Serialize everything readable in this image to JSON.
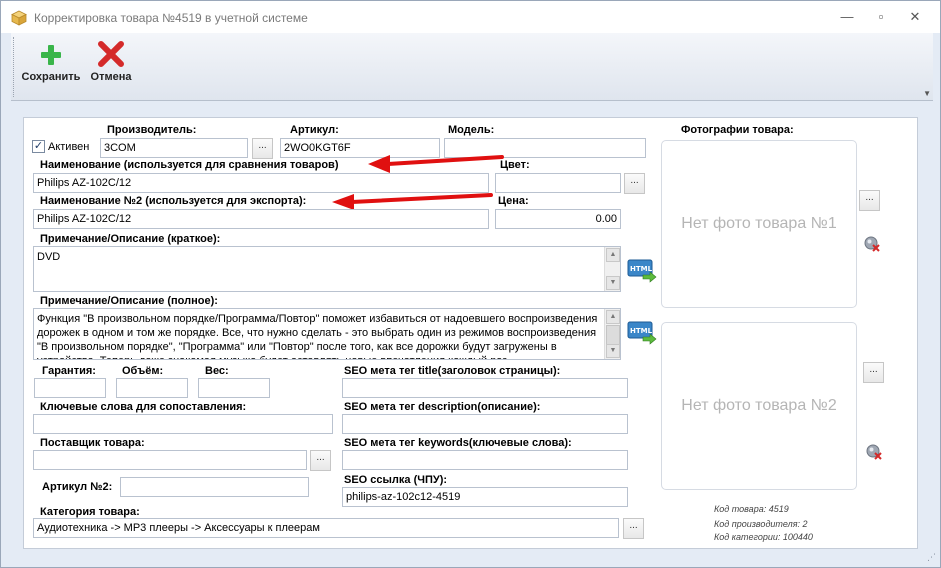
{
  "window": {
    "title": "Корректировка товара №4519 в учетной системе",
    "controls": {
      "minimize": "—",
      "maximize": "▫",
      "close": "✕"
    }
  },
  "toolbar": {
    "save_label": "Сохранить",
    "cancel_label": "Отмена"
  },
  "form": {
    "active_label": "Активен",
    "active_checked": "✓",
    "manufacturer_label": "Производитель:",
    "manufacturer_value": "3COM",
    "article_label": "Артикул:",
    "article_value": "2WO0KGT6F",
    "model_label": "Модель:",
    "model_value": "",
    "name_label": "Наименование (используется для сравнения товаров)",
    "name_value": "Philips AZ-102C/12",
    "color_label": "Цвет:",
    "color_value": "",
    "name2_label": "Наименование №2 (используется для экспорта):",
    "name2_value": "Philips AZ-102C/12",
    "price_label": "Цена:",
    "price_value": "0.00",
    "short_desc_label": "Примечание/Описание (краткое):",
    "short_desc_value": "DVD",
    "full_desc_label": "Примечание/Описание (полное):",
    "full_desc_value": "Функция \"В произвольном порядке/Программа/Повтор\" поможет избавиться от надоевшего воспроизведения дорожек в одном и том же порядке. Все, что нужно сделать - это выбрать один из режимов воспроизведения \"В произвольном порядке\", \"Программа\" или \"Повтор\" после того, как все дорожки будут загружены в устройство. Теперь даже знакомая музыка будет оставлять новые впечатления каждый раз",
    "warranty_label": "Гарантия:",
    "volume_label": "Объём:",
    "weight_label": "Вес:",
    "warranty_value": "",
    "volume_value": "",
    "weight_value": "",
    "keywords_label": "Ключевые слова для сопоставления:",
    "keywords_value": "",
    "supplier_label": "Поставщик товара:",
    "supplier_value": "",
    "article2_label": "Артикул №2:",
    "article2_value": "",
    "category_label": "Категория товара:",
    "category_value": "Аудиотехника -> MP3 плееры -> Аксессуары к плеерам",
    "seo_title_label": "SEO мета тег title(заголовок страницы):",
    "seo_title_value": "",
    "seo_desc_label": "SEO мета тег description(описание):",
    "seo_desc_value": "",
    "seo_keywords_label": "SEO мета тег keywords(ключевые слова):",
    "seo_keywords_value": "",
    "seo_url_label": "SEO ссылка (ЧПУ):",
    "seo_url_value": "philips-az-102c12-4519",
    "ellipsis": "..."
  },
  "photos": {
    "header": "Фотографии товара:",
    "photo1": "Нет фото товара №1",
    "photo2": "Нет фото товара №2"
  },
  "info": {
    "product_code": "Код товара: 4519",
    "manufacturer_code": "Код производителя: 2",
    "category_code": "Код категории: 100440"
  },
  "colors": {
    "arrow": "#e01010",
    "accent": "#3a86c8",
    "save_green": "#39b54a",
    "cancel_red": "#d42a2a"
  }
}
